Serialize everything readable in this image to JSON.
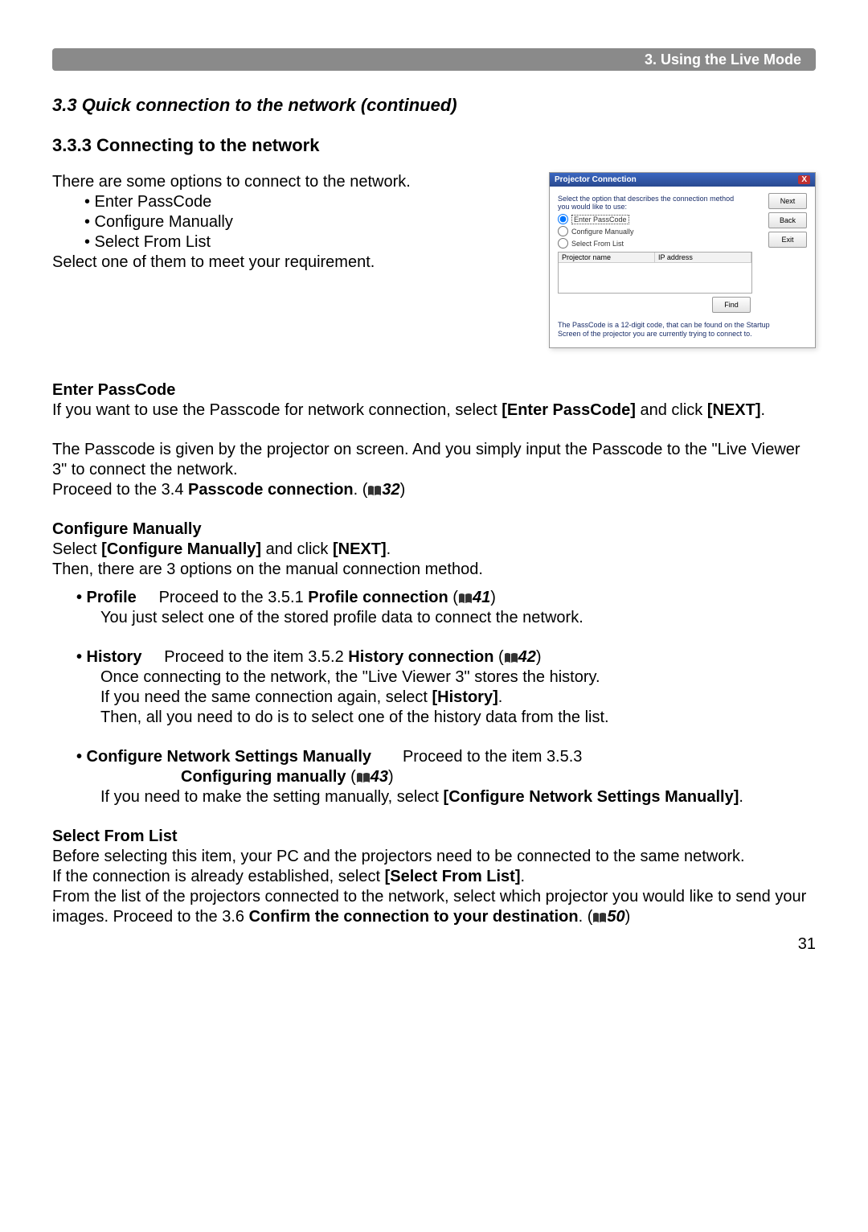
{
  "header": {
    "chapter": "3. Using the Live Mode"
  },
  "titles": {
    "section": "3.3 Quick connection to the network (continued)",
    "subsection": "3.3.3 Connecting to the network"
  },
  "intro": {
    "line1": "There are some options to connect to the network.",
    "bullets": [
      "• Enter PassCode",
      "• Configure Manually",
      "• Select From List"
    ],
    "line2": "Select one of them to meet your requirement."
  },
  "dialog": {
    "title": "Projector Connection",
    "close": "X",
    "prompt1": "Select the option that describes the connection method",
    "prompt2": "you would like to use:",
    "opts": [
      "Enter PassCode",
      "Configure Manually",
      "Select From List"
    ],
    "cols": [
      "Projector name",
      "IP address"
    ],
    "buttons": {
      "next": "Next",
      "back": "Back",
      "exit": "Exit",
      "find": "Find"
    },
    "footer1": "The PassCode is a 12-digit code, that can be found on the Startup",
    "footer2": "Screen of the projector you are currently trying to connect to."
  },
  "enter_passcode": {
    "heading": "Enter PassCode",
    "p1a": "If you want to use the Passcode for network connection, select ",
    "p1b": "[Enter PassCode]",
    "p1c": " and click ",
    "p1d": "[NEXT]",
    "p1e": ".",
    "p2": "The Passcode is given by the projector on screen. And you simply input the Passcode to the \"Live Viewer 3\" to connect the network.",
    "p3a": "Proceed to the 3.4 ",
    "p3b": "Passcode connection",
    "p3c": ". (",
    "p3d": "32",
    "p3e": ")"
  },
  "configure_manually": {
    "heading": "Configure Manually",
    "p1a": "Select ",
    "p1b": "[Configure Manually]",
    "p1c": " and click ",
    "p1d": "[NEXT]",
    "p1e": ".",
    "p2": "Then, there are 3 options on the manual connection method.",
    "profile": {
      "label": "• Profile",
      "t1": "Proceed to the 3.5.1 ",
      "t2": "Profile connection",
      "t3": " (",
      "ref": "41",
      "t4": ")",
      "desc": "You just select one of the stored profile data to connect the network."
    },
    "history": {
      "label": "• History",
      "t1": "Proceed to the item 3.5.2 ",
      "t2": "History connection",
      "t3": " (",
      "ref": "42",
      "t4": ")",
      "d1": "Once connecting to the network, the \"Live Viewer 3\" stores the history.",
      "d2a": "If you need the same connection again, select ",
      "d2b": "[History]",
      "d2c": ".",
      "d3": "Then, all you need to do is to select one of the history data from the list."
    },
    "manual": {
      "label": "• Configure Network Settings Manually",
      "t1": "Proceed to the item 3.5.3",
      "t2": "Configuring manually",
      "t3": " (",
      "ref": "43",
      "t4": ")",
      "d1a": "If you need to make the setting manually, select ",
      "d1b": "[Configure Network Settings Manually]",
      "d1c": "."
    }
  },
  "select_from_list": {
    "heading": "Select From List",
    "p1": "Before selecting this item, your PC and the projectors need to be connected to the same network.",
    "p2a": "If the connection is already established, select ",
    "p2b": "[Select From List]",
    "p2c": ".",
    "p3a": "From the list of the projectors connected to the network, select which projector you would like to send your images. Proceed to the 3.6 ",
    "p3b": "Confirm the connection to your destination",
    "p3c": ". (",
    "p3d": "50",
    "p3e": ")"
  },
  "page_number": "31"
}
